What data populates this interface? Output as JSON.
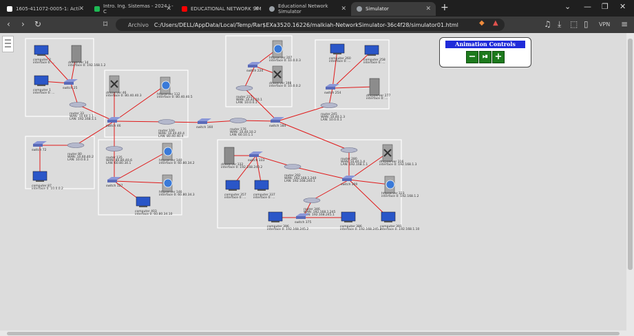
{
  "browser": {
    "tabs": [
      {
        "title": "1605-411072-0005-1: Acti",
        "icon_color": "#ffffff"
      },
      {
        "title": "Intro. Ing. Sistemas - 2024 I - C",
        "icon_color": "#1db954"
      },
      {
        "title": "EDUCATIONAL NETWORK SIM",
        "icon_color": "#ff0000"
      },
      {
        "title": "Educational Network Simulator",
        "icon_color": "#9aa0a6"
      },
      {
        "title": "Simulator",
        "icon_color": "#9aa0a6",
        "active": true
      }
    ],
    "new_tab": "+",
    "address": {
      "chip": "Archivo",
      "url": "C:/Users/DELL/AppData/Local/Temp/Rar$EXa3520.16226/malkiah-NetworkSimulator-36c4f28/simulator01.html"
    },
    "vpn_label": "VPN"
  },
  "animation_controls": {
    "title": "Animation Controls",
    "minus": "−",
    "play_pause": "⏯",
    "plus": "+"
  },
  "colors": {
    "link": "#e01818",
    "group_border": "#ffffff",
    "switch": "#5a6ab8",
    "router": "#8a8fb0"
  },
  "devices": [
    {
      "id": "c2",
      "type": "computer",
      "name": "computer 2",
      "iface": "interface 0: ..."
    },
    {
      "id": "dns14",
      "type": "server",
      "name": "dnsserver 14",
      "iface": "interface 0: 192.168.1.2"
    },
    {
      "id": "c1",
      "type": "computer",
      "name": "computer 1",
      "iface": "interface 0: ..."
    },
    {
      "id": "sw25",
      "type": "switch",
      "name": "switch 25"
    },
    {
      "id": "r33",
      "type": "router",
      "name": "router 33",
      "iface": "WAN: 10.60.1.1",
      "lan": "LAN: 192.168.1.1"
    },
    {
      "id": "dns46",
      "type": "tools",
      "name": "dnsserver 46",
      "iface": "interface 0: 80.40.40.3"
    },
    {
      "id": "http112",
      "type": "web",
      "name": "httpserver 112",
      "iface": "interface 0: 80.40.40.5"
    },
    {
      "id": "sw46",
      "type": "switch",
      "name": "switch 46"
    },
    {
      "id": "r100",
      "type": "router",
      "name": "router 100",
      "iface": "WAN: 10.40.40.4",
      "lan": "LAN: 80.40.40.4"
    },
    {
      "id": "sw160",
      "type": "switch",
      "name": "switch 160"
    },
    {
      "id": "http207",
      "type": "web",
      "name": "httpserver 207",
      "iface": "interface 0: 10.0.0.3"
    },
    {
      "id": "sw220",
      "type": "switch",
      "name": "switch 220"
    },
    {
      "id": "http198",
      "type": "tools",
      "name": "dnsserver 198",
      "iface": "interface 0: 10.0.0.2"
    },
    {
      "id": "r215",
      "type": "router",
      "name": "router 215",
      "iface": "WAN: 10.40.10.1",
      "lan": "LAN: 10.0.0.1"
    },
    {
      "id": "r176",
      "type": "router",
      "name": "router 176",
      "iface": "WAN: 10.40.10.2",
      "lan": "LAN: 60.10.1.1"
    },
    {
      "id": "sw184",
      "type": "switch",
      "name": "switch 184"
    },
    {
      "id": "c260",
      "type": "computer",
      "name": "computer 260",
      "iface": "interface 0: ..."
    },
    {
      "id": "c258",
      "type": "computer",
      "name": "computer 258",
      "iface": "interface 0: ..."
    },
    {
      "id": "sw254",
      "type": "switch",
      "name": "switch 254"
    },
    {
      "id": "dhcp277",
      "type": "server",
      "name": "dhcpserver 277",
      "iface": "interface 0: ..."
    },
    {
      "id": "r245",
      "type": "router",
      "name": "router 245",
      "iface": "WAN: 10.40.1.3",
      "lan": "LAN: 10.0.0.1"
    },
    {
      "id": "sw72",
      "type": "switch",
      "name": "switch 72"
    },
    {
      "id": "r80",
      "type": "router",
      "name": "router 80",
      "iface": "WAN: 10.60.40.2",
      "lan": "LAN: 10.0.0.1"
    },
    {
      "id": "c87",
      "type": "computer",
      "name": "computer 87",
      "iface": "interface 0: 10.0.0.2"
    },
    {
      "id": "r135",
      "type": "router",
      "name": "router 135",
      "iface": "WAN: 80.80.40.6",
      "lan": "LAN: 60.80.34.1"
    },
    {
      "id": "http140",
      "type": "web",
      "name": "httpserver 140",
      "iface": "interface 0: 60.80.34.2"
    },
    {
      "id": "sw127",
      "type": "switch",
      "name": "switch 127"
    },
    {
      "id": "http146",
      "type": "web",
      "name": "httpserver 146",
      "iface": "interface 0: 60.80.34.3"
    },
    {
      "id": "c403",
      "type": "computer",
      "name": "computer 403",
      "iface": "interface 0: 60.80.34.10"
    },
    {
      "id": "dns332",
      "type": "server",
      "name": "dnsserver 332",
      "iface": "interface 0: 192.168.240.2"
    },
    {
      "id": "sw333",
      "type": "switch",
      "name": "switch 333"
    },
    {
      "id": "c357",
      "type": "computer",
      "name": "computer 357",
      "iface": "interface 0: ..."
    },
    {
      "id": "c357b",
      "type": "computer",
      "name": "computer 337",
      "iface": "interface 0: ..."
    },
    {
      "id": "r292",
      "type": "router",
      "name": "router 292",
      "iface": "WAN: 192.168.1.240",
      "lan": "LAN: 192.168.240.1"
    },
    {
      "id": "r280",
      "type": "router",
      "name": "router 280",
      "iface": "WAN: 10.40.1.4",
      "lan": "LAN: 192.168.1.1"
    },
    {
      "id": "dhcp316",
      "type": "tools",
      "name": "dhcpserver 316",
      "iface": "interface 0: 192.168.1.3"
    },
    {
      "id": "sw300",
      "type": "switch",
      "name": "switch 300"
    },
    {
      "id": "http323",
      "type": "web",
      "name": "httpserver 323",
      "iface": "interface 0: 192.168.1.2"
    },
    {
      "id": "r346",
      "type": "router",
      "name": "router 346",
      "iface": "WAN: 192.168.1.245",
      "lan": "LAN: 192.168.245.1"
    },
    {
      "id": "c396",
      "type": "computer",
      "name": "computer 396",
      "iface": "interface 0: 192.168.245.2"
    },
    {
      "id": "sw375",
      "type": "switch",
      "name": "switch 375"
    },
    {
      "id": "c386",
      "type": "computer",
      "name": "computer 386",
      "iface": "interface 0: 192.168.245.3"
    },
    {
      "id": "c391",
      "type": "computer",
      "name": "computer 391",
      "iface": "interface 0: 192.168.1.10"
    }
  ]
}
